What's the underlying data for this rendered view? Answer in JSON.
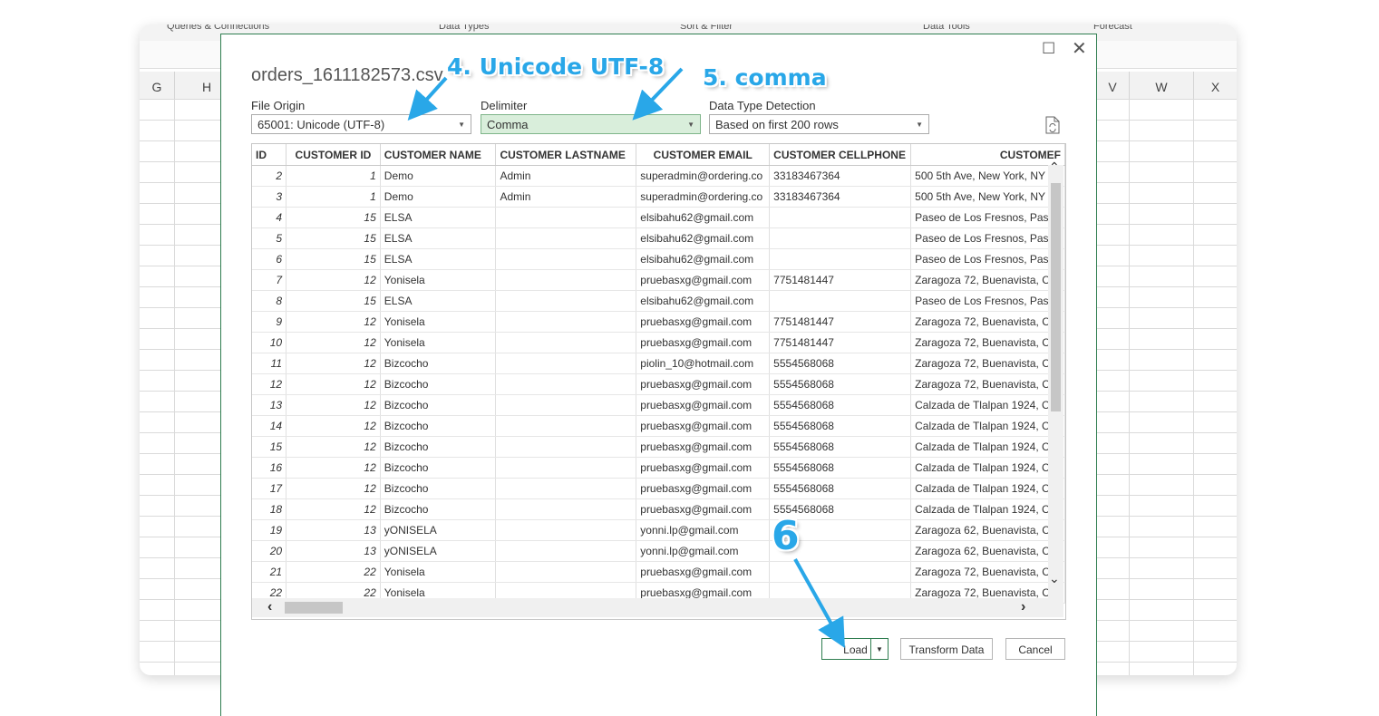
{
  "excel": {
    "ribbon_groups": [
      "Queries & Connections",
      "Data Types",
      "Sort & Filter",
      "Data Tools",
      "Forecast"
    ],
    "columns_left": [
      "G",
      "H"
    ],
    "columns_right": [
      "V",
      "W",
      "X"
    ]
  },
  "dialog": {
    "title": "orders_1611182573.csv",
    "file_origin": {
      "label": "File Origin",
      "value": "65001: Unicode (UTF-8)"
    },
    "delimiter": {
      "label": "Delimiter",
      "value": "Comma"
    },
    "data_type_detection": {
      "label": "Data Type Detection",
      "value": "Based on first 200 rows"
    },
    "buttons": {
      "load": "Load",
      "transform": "Transform Data",
      "cancel": "Cancel"
    }
  },
  "table": {
    "headers": [
      "ID",
      "CUSTOMER ID",
      "CUSTOMER NAME",
      "CUSTOMER LASTNAME",
      "CUSTOMER EMAIL",
      "CUSTOMER CELLPHONE",
      "CUSTOMEF"
    ],
    "rows": [
      [
        "2",
        "1",
        "Demo",
        "Admin",
        "superadmin@ordering.co",
        "33183467364",
        "500 5th Ave, New York, NY"
      ],
      [
        "3",
        "1",
        "Demo",
        "Admin",
        "superadmin@ordering.co",
        "33183467364",
        "500 5th Ave, New York, NY"
      ],
      [
        "4",
        "15",
        "ELSA",
        "",
        "elsibahu62@gmail.com",
        "",
        "Paseo de Los Fresnos, Pase"
      ],
      [
        "5",
        "15",
        "ELSA",
        "",
        "elsibahu62@gmail.com",
        "",
        "Paseo de Los Fresnos, Pase"
      ],
      [
        "6",
        "15",
        "ELSA",
        "",
        "elsibahu62@gmail.com",
        "",
        "Paseo de Los Fresnos, Pase"
      ],
      [
        "7",
        "12",
        "Yonisela",
        "",
        "pruebasxg@gmail.com",
        "7751481447",
        "Zaragoza 72, Buenavista, C"
      ],
      [
        "8",
        "15",
        "ELSA",
        "",
        "elsibahu62@gmail.com",
        "",
        "Paseo de Los Fresnos, Pase"
      ],
      [
        "9",
        "12",
        "Yonisela",
        "",
        "pruebasxg@gmail.com",
        "7751481447",
        "Zaragoza 72, Buenavista, C"
      ],
      [
        "10",
        "12",
        "Yonisela",
        "",
        "pruebasxg@gmail.com",
        "7751481447",
        "Zaragoza 72, Buenavista, C"
      ],
      [
        "11",
        "12",
        "Bizcocho",
        "",
        "piolin_10@hotmail.com",
        "5554568068",
        "Zaragoza 72, Buenavista, C"
      ],
      [
        "12",
        "12",
        "Bizcocho",
        "",
        "pruebasxg@gmail.com",
        "5554568068",
        "Zaragoza 72, Buenavista, C"
      ],
      [
        "13",
        "12",
        "Bizcocho",
        "",
        "pruebasxg@gmail.com",
        "5554568068",
        "Calzada de Tlalpan 1924, C"
      ],
      [
        "14",
        "12",
        "Bizcocho",
        "",
        "pruebasxg@gmail.com",
        "5554568068",
        "Calzada de Tlalpan 1924, C"
      ],
      [
        "15",
        "12",
        "Bizcocho",
        "",
        "pruebasxg@gmail.com",
        "5554568068",
        "Calzada de Tlalpan 1924, C"
      ],
      [
        "16",
        "12",
        "Bizcocho",
        "",
        "pruebasxg@gmail.com",
        "5554568068",
        "Calzada de Tlalpan 1924, C"
      ],
      [
        "17",
        "12",
        "Bizcocho",
        "",
        "pruebasxg@gmail.com",
        "5554568068",
        "Calzada de Tlalpan 1924, C"
      ],
      [
        "18",
        "12",
        "Bizcocho",
        "",
        "pruebasxg@gmail.com",
        "5554568068",
        "Calzada de Tlalpan 1924, C"
      ],
      [
        "19",
        "13",
        "yONISELA",
        "",
        "yonni.lp@gmail.com",
        "",
        "Zaragoza 62, Buenavista, C"
      ],
      [
        "20",
        "13",
        "yONISELA",
        "",
        "yonni.lp@gmail.com",
        "",
        "Zaragoza 62, Buenavista, C"
      ],
      [
        "21",
        "22",
        "Yonisela",
        "",
        "pruebasxg@gmail.com",
        "",
        "Zaragoza 72, Buenavista, C"
      ],
      [
        "22",
        "22",
        "Yonisela",
        "",
        "pruebasxg@gmail.com",
        "",
        "Zaragoza 72, Buenavista, C"
      ]
    ]
  },
  "annotations": {
    "step4": "4. Unicode UTF-8",
    "step5": "5. comma",
    "step6": "6",
    "color": "#29a7e8"
  },
  "icons": {
    "maximize": "maximize-icon",
    "close": "close-icon",
    "refresh": "refresh-file-icon"
  }
}
